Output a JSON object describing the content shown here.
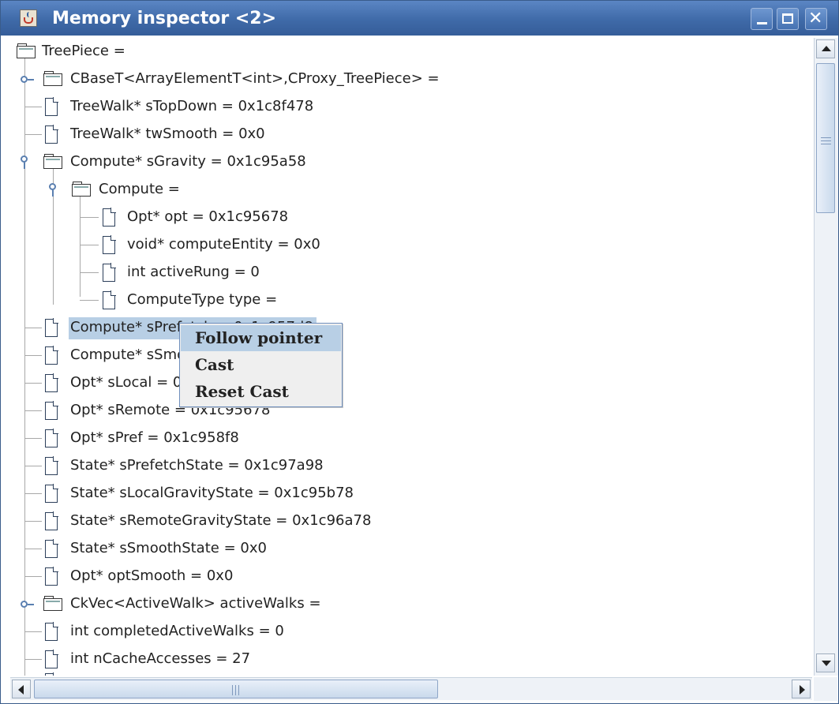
{
  "window": {
    "title": "Memory inspector <2>",
    "buttons": {
      "minimize": "minimize-icon",
      "maximize": "maximize-icon",
      "close": "close-icon"
    }
  },
  "tree": {
    "root": "TreePiece =",
    "nodes": [
      {
        "label": "CBaseT<ArrayElementT<int>,CProxy_TreePiece> =",
        "type": "folder"
      },
      {
        "label": "TreeWalk* sTopDown = 0x1c8f478",
        "type": "leaf"
      },
      {
        "label": "TreeWalk* twSmooth = 0x0",
        "type": "leaf"
      },
      {
        "label": "Compute* sGravity = 0x1c95a58",
        "type": "folder",
        "expanded": true
      },
      {
        "label": "Compute =",
        "type": "folder",
        "expanded": true
      },
      {
        "label": "Opt* opt = 0x1c95678",
        "type": "leaf"
      },
      {
        "label": "void* computeEntity = 0x0",
        "type": "leaf"
      },
      {
        "label": "int activeRung = 0",
        "type": "leaf"
      },
      {
        "label": "ComputeType type =",
        "type": "leaf"
      },
      {
        "label": "Compute* sPrefetch = 0x1c957d8",
        "type": "leaf",
        "selected": true
      },
      {
        "label": "Compute* sSmooth = 0x0",
        "type": "leaf"
      },
      {
        "label": "Opt* sLocal = 0x1c95678",
        "type": "leaf"
      },
      {
        "label": "Opt* sRemote = 0x1c95678",
        "type": "leaf"
      },
      {
        "label": "Opt* sPref = 0x1c958f8",
        "type": "leaf"
      },
      {
        "label": "State* sPrefetchState = 0x1c97a98",
        "type": "leaf"
      },
      {
        "label": "State* sLocalGravityState = 0x1c95b78",
        "type": "leaf"
      },
      {
        "label": "State* sRemoteGravityState = 0x1c96a78",
        "type": "leaf"
      },
      {
        "label": "State* sSmoothState = 0x0",
        "type": "leaf"
      },
      {
        "label": "Opt* optSmooth = 0x0",
        "type": "leaf"
      },
      {
        "label": "CkVec<ActiveWalk> activeWalks =",
        "type": "folder"
      },
      {
        "label": "int completedActiveWalks = 0",
        "type": "leaf"
      },
      {
        "label": "int nCacheAccesses = 27",
        "type": "leaf"
      }
    ]
  },
  "context_menu": {
    "items": [
      "Follow pointer",
      "Cast",
      "Reset Cast"
    ],
    "active_index": 0
  },
  "colors": {
    "titlebar": "#4672b2",
    "selection": "#b8cfe5",
    "menu_background": "#efefef"
  }
}
